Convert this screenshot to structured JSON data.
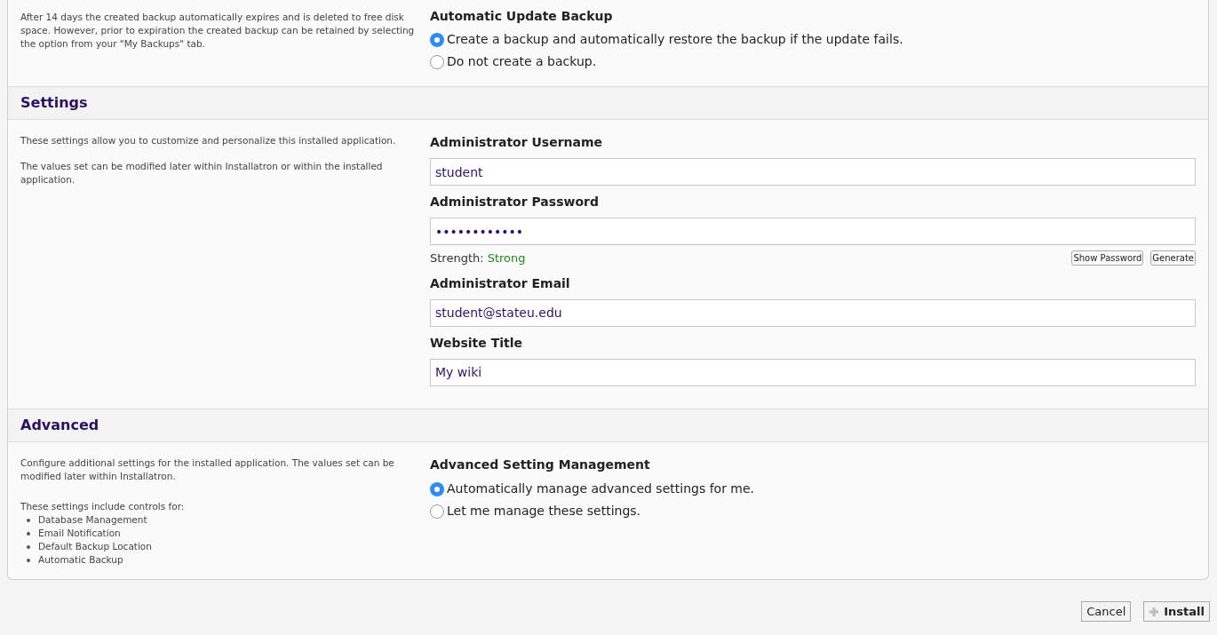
{
  "backup": {
    "description": "After 14 days the created backup automatically expires and is deleted to free disk space. However, prior to expiration the created backup can be retained by selecting the option from your \"My Backups\" tab.",
    "label": "Automatic Update Backup",
    "options": [
      {
        "label": "Create a backup and automatically restore the backup if the update fails.",
        "selected": true
      },
      {
        "label": "Do not create a backup.",
        "selected": false
      }
    ]
  },
  "settings": {
    "title": "Settings",
    "paragraphs": [
      "These settings allow you to customize and personalize this installed application.",
      "The values set can be modified later within Installatron or within the installed application."
    ],
    "fields": [
      {
        "label": "Administrator Username",
        "value": "student"
      },
      {
        "label": "Administrator Password",
        "value": "••••••••••••",
        "strength_label": "Strength:",
        "strength": "Strong",
        "buttons": [
          "Show Password",
          "Generate"
        ]
      },
      {
        "label": "Administrator Email",
        "value": "student@stateu.edu"
      },
      {
        "label": "Website Title",
        "value": "My wiki"
      }
    ]
  },
  "advanced": {
    "title": "Advanced",
    "paragraphs": [
      "Configure additional settings for the installed application. The values set can be modified later within Installatron.",
      "These settings include controls for:"
    ],
    "list": [
      "Database Management",
      "Email Notification",
      "Default Backup Location",
      "Automatic Backup"
    ],
    "label": "Advanced Setting Management",
    "options": [
      {
        "label": "Automatically manage advanced settings for me.",
        "selected": true
      },
      {
        "label": "Let me manage these settings.",
        "selected": false
      }
    ]
  },
  "footer": {
    "buttons": [
      "Cancel",
      "Install"
    ]
  }
}
